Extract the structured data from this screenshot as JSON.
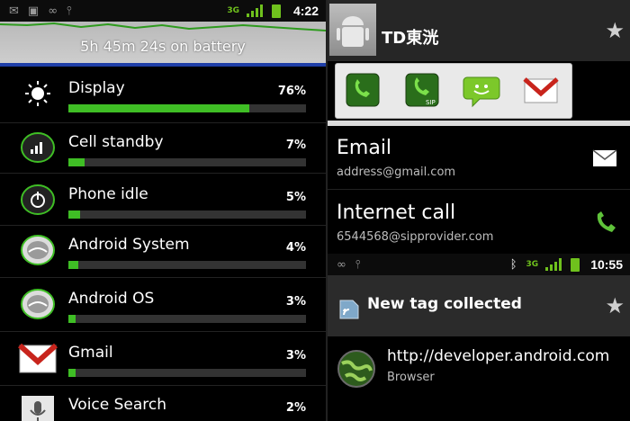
{
  "left": {
    "status": {
      "time": "4:22",
      "network": "3G",
      "icons": [
        "mail-icon",
        "briefcase-icon",
        "voicemail-icon",
        "usb-icon"
      ]
    },
    "graph_text": "5h 45m 24s on battery",
    "usage": [
      {
        "label": "Display",
        "pct": "76%",
        "fraction": 0.76,
        "icon": "brightness-icon"
      },
      {
        "label": "Cell standby",
        "pct": "7%",
        "fraction": 0.07,
        "icon": "signal-icon"
      },
      {
        "label": "Phone idle",
        "pct": "5%",
        "fraction": 0.05,
        "icon": "power-icon"
      },
      {
        "label": "Android System",
        "pct": "4%",
        "fraction": 0.04,
        "icon": "android-icon"
      },
      {
        "label": "Android OS",
        "pct": "3%",
        "fraction": 0.03,
        "icon": "android-icon"
      },
      {
        "label": "Gmail",
        "pct": "3%",
        "fraction": 0.03,
        "icon": "gmail-icon"
      },
      {
        "label": "Voice Search",
        "pct": "2%",
        "fraction": 0.02,
        "icon": "microphone-icon"
      }
    ]
  },
  "right": {
    "contact": {
      "name": "TD東洸"
    },
    "quick_actions": [
      "phone-icon",
      "sip-phone-icon",
      "sms-icon",
      "gmail-icon"
    ],
    "entries": [
      {
        "title": "Email",
        "subtitle": "address@gmail.com",
        "icon": "envelope-icon"
      },
      {
        "title": "Internet call",
        "subtitle": "6544568@sipprovider.com",
        "icon": "phone-icon"
      }
    ],
    "status2": {
      "time": "10:55",
      "network": "3G",
      "icons": [
        "voicemail-icon",
        "usb-icon",
        "bluetooth-icon"
      ]
    },
    "tag": {
      "title": "New tag collected",
      "url": "http://developer.android.com",
      "app": "Browser"
    },
    "colors": {
      "accent_green": "#3fbe25",
      "gmail_red": "#c8241c"
    }
  }
}
